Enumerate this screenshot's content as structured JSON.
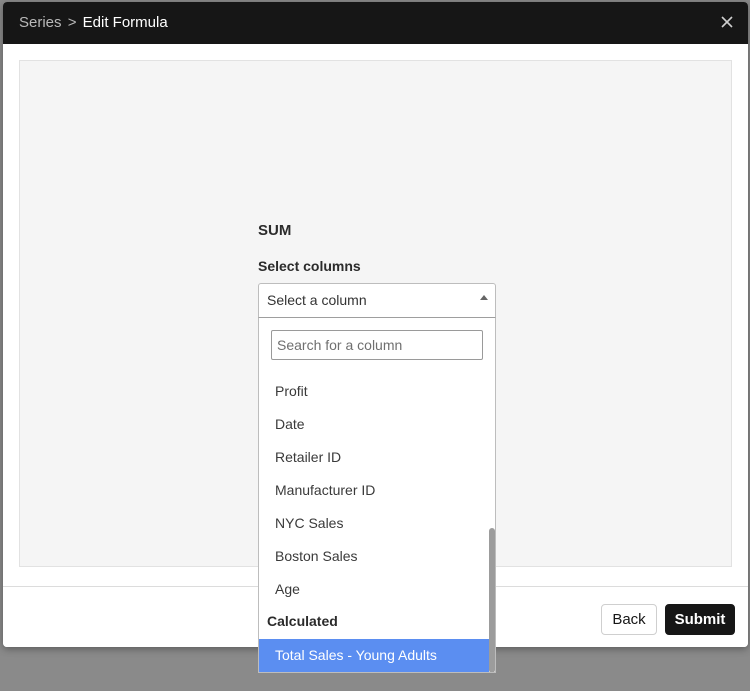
{
  "header": {
    "breadcrumb_parent": "Series",
    "breadcrumb_separator": ">",
    "breadcrumb_current": "Edit Formula",
    "close_icon": "close-icon"
  },
  "formula": {
    "function_name": "SUM",
    "select_label": "Select columns",
    "select_value": "Select a column"
  },
  "dropdown": {
    "search_placeholder": "Search for a column",
    "options": [
      "Profit",
      "Date",
      "Retailer ID",
      "Manufacturer ID",
      "NYC Sales",
      "Boston Sales",
      "Age"
    ],
    "group_label": "Calculated",
    "selected_option": "Total Sales - Young Adults"
  },
  "footer": {
    "back_label": "Back",
    "submit_label": "Submit"
  },
  "colors": {
    "header_bg": "#161616",
    "selected_bg": "#5b8ef1",
    "submit_bg": "#161616"
  }
}
